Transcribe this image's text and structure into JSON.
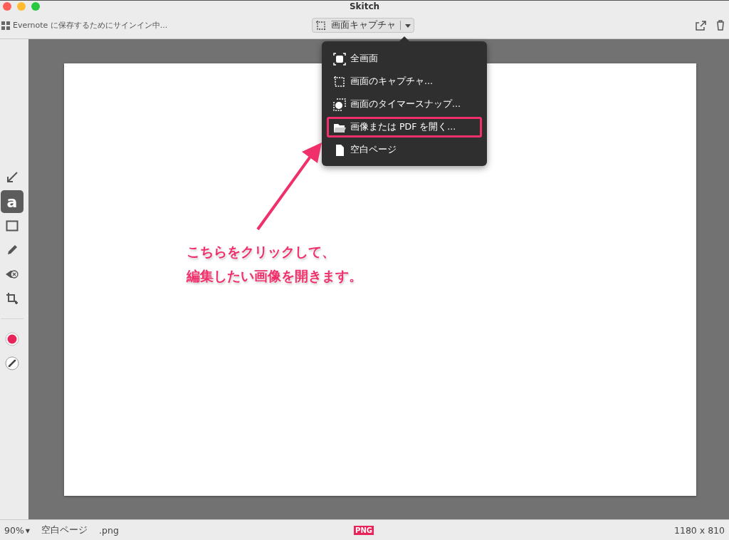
{
  "window": {
    "title": "Skitch"
  },
  "toolbar": {
    "status": "Evernote に保存するためにサインイン中...",
    "capture_button": "画面キャプチャ"
  },
  "menu": {
    "items": [
      {
        "kind": "fullscreen",
        "label": "全画面",
        "highlighted": false
      },
      {
        "kind": "crosshair",
        "label": "画面のキャプチャ...",
        "highlighted": false
      },
      {
        "kind": "timer",
        "label": "画面のタイマースナップ...",
        "highlighted": false
      },
      {
        "kind": "folder",
        "label": "画像または PDF を開く...",
        "highlighted": true
      },
      {
        "kind": "page",
        "label": "空白ページ",
        "highlighted": false
      }
    ]
  },
  "tools": [
    {
      "kind": "arrow",
      "selected": false
    },
    {
      "kind": "text",
      "glyph": "a",
      "selected": true
    },
    {
      "kind": "rectangle",
      "selected": false
    },
    {
      "kind": "pen",
      "selected": false
    },
    {
      "kind": "eraser",
      "selected": false
    },
    {
      "kind": "crop",
      "selected": false
    },
    {
      "kind": "color",
      "color": "#e8245a",
      "selected": false
    },
    {
      "kind": "stroke",
      "selected": false
    }
  ],
  "annotation": {
    "lines": [
      "こちらをクリックして、",
      "編集したい画像を開きます。"
    ]
  },
  "status_bar": {
    "zoom": "90%",
    "zoom_caret": "▾",
    "name": "空白ページ",
    "format": ".png",
    "file_badge": "PNG",
    "dimensions": "1180 x 810"
  }
}
